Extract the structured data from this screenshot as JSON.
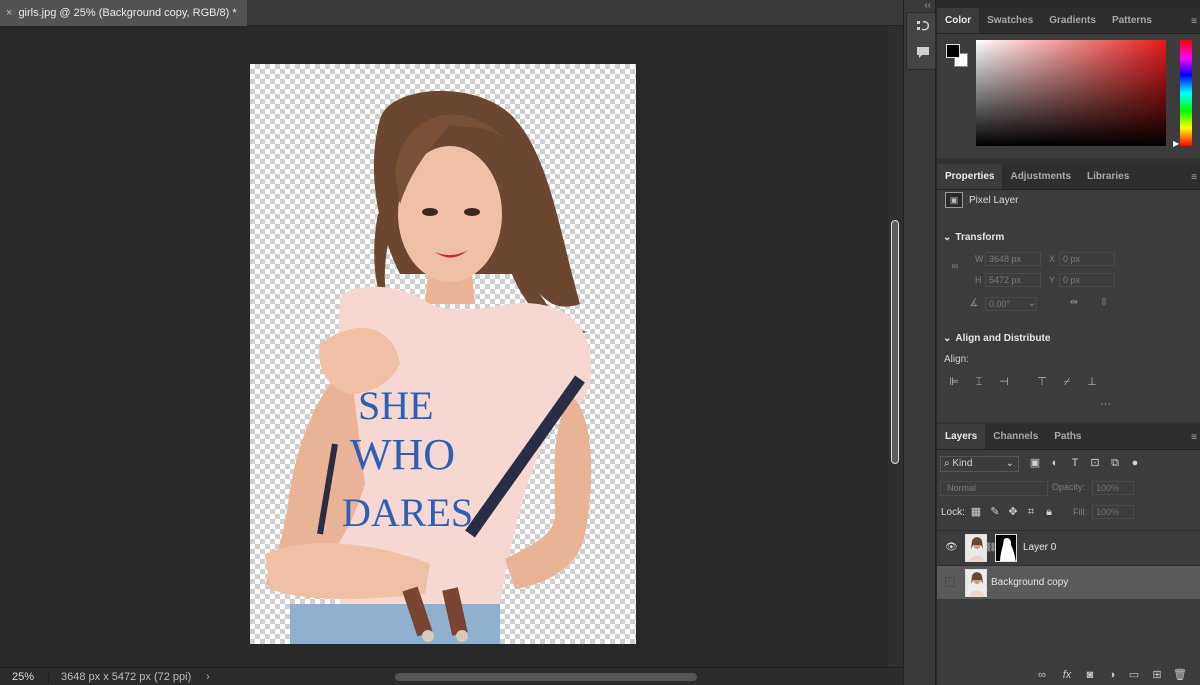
{
  "document_tab": {
    "close": "×",
    "title": "girls.jpg @ 25% (Background copy, RGB/8) *"
  },
  "canvas": {
    "shirt_text": [
      "SHE",
      "WHO",
      "DARES"
    ]
  },
  "status": {
    "zoom": "25%",
    "doc_info": "3648 px x 5472 px (72 ppi)",
    "arrow": "›"
  },
  "dock": {
    "collapse": "‹‹",
    "icons": [
      "history-icon",
      "comment-icon"
    ]
  },
  "color_panel": {
    "tabs": [
      "Color",
      "Swatches",
      "Gradients",
      "Patterns"
    ],
    "active_tab": "Color",
    "foreground": "#000000",
    "background": "#ffffff",
    "hue": "#e61a1a"
  },
  "properties_panel": {
    "tabs": [
      "Properties",
      "Adjustments",
      "Libraries"
    ],
    "layer_type": "Pixel Layer",
    "transform_heading": "Transform",
    "w_label": "W",
    "w_value": "3648 px",
    "h_label": "H",
    "h_value": "5472 px",
    "x_label": "X",
    "x_value": "0 px",
    "y_label": "Y",
    "y_value": "0 px",
    "angle_value": "0.00°",
    "align_heading": "Align and Distribute",
    "align_label": "Align:",
    "more": "···"
  },
  "layers_panel": {
    "tabs": [
      "Layers",
      "Channels",
      "Paths"
    ],
    "kind_filter": "Kind",
    "blend_mode": "Normal",
    "opacity_label": "Opacity:",
    "opacity_value": "100%",
    "lock_label": "Lock:",
    "fill_label": "Fill:",
    "fill_value": "100%",
    "layers": [
      {
        "name": "Layer 0",
        "visible": true,
        "has_mask": true,
        "selected": false
      },
      {
        "name": "Background copy",
        "visible": false,
        "has_mask": false,
        "selected": true
      }
    ]
  }
}
